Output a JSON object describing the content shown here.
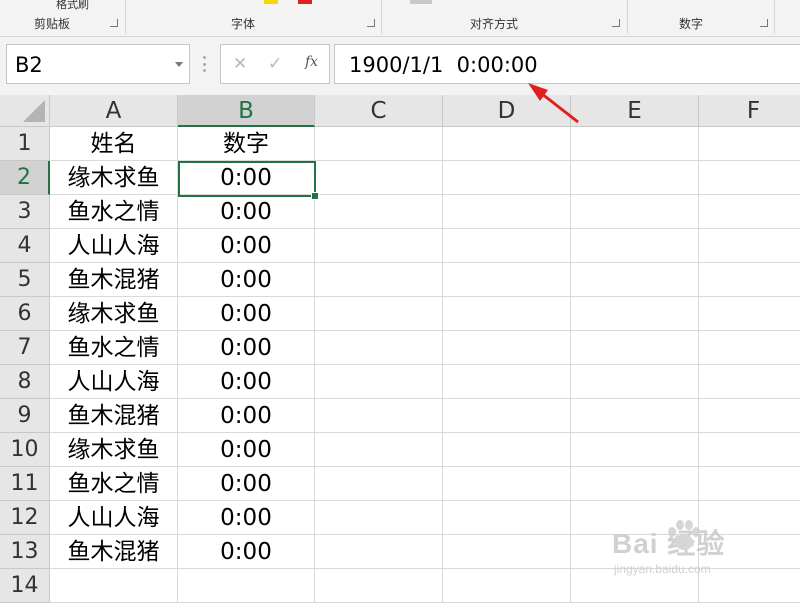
{
  "ribbon": {
    "top_item": "格式刷",
    "groups": [
      "剪贴板",
      "字体",
      "对齐方式",
      "数字"
    ]
  },
  "formula_bar": {
    "name_box": "B2",
    "cancel_icon": "✕",
    "enter_icon": "✓",
    "fx_label": "fx",
    "formula": "1900/1/1  0:00:00"
  },
  "columns": [
    "A",
    "B",
    "C",
    "D",
    "E",
    "F"
  ],
  "rows": [
    {
      "num": "1",
      "a": "姓名",
      "b": "数字"
    },
    {
      "num": "2",
      "a": "缘木求鱼",
      "b": "0:00"
    },
    {
      "num": "3",
      "a": "鱼水之情",
      "b": "0:00"
    },
    {
      "num": "4",
      "a": "人山人海",
      "b": "0:00"
    },
    {
      "num": "5",
      "a": "鱼木混猪",
      "b": "0:00"
    },
    {
      "num": "6",
      "a": "缘木求鱼",
      "b": "0:00"
    },
    {
      "num": "7",
      "a": "鱼水之情",
      "b": "0:00"
    },
    {
      "num": "8",
      "a": "人山人海",
      "b": "0:00"
    },
    {
      "num": "9",
      "a": "鱼木混猪",
      "b": "0:00"
    },
    {
      "num": "10",
      "a": "缘木求鱼",
      "b": "0:00"
    },
    {
      "num": "11",
      "a": "鱼水之情",
      "b": "0:00"
    },
    {
      "num": "12",
      "a": "人山人海",
      "b": "0:00"
    },
    {
      "num": "13",
      "a": "鱼木混猪",
      "b": "0:00"
    },
    {
      "num": "14",
      "a": "",
      "b": ""
    }
  ],
  "selected_cell": "B2",
  "watermark": {
    "main": "Bai  经验",
    "sub": "jingyan.baidu.com"
  },
  "colors": {
    "accent": "#217346",
    "arrow": "#e02020"
  }
}
